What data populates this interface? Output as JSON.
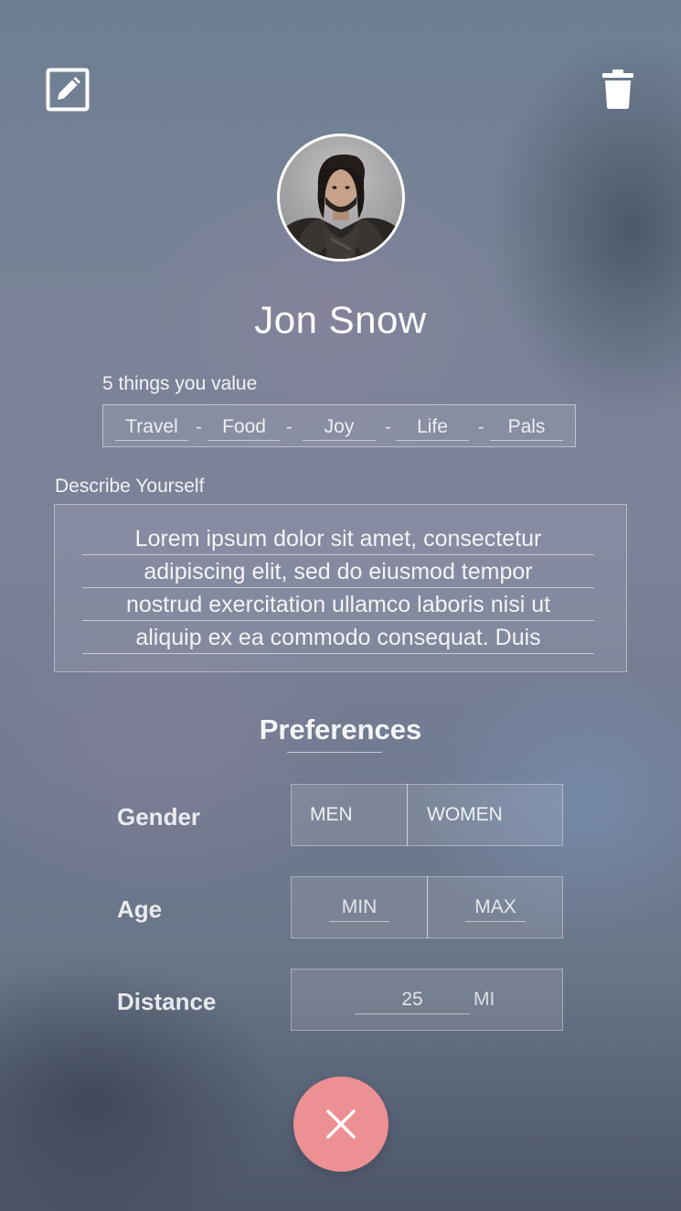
{
  "header": {
    "edit_icon": "edit-icon",
    "delete_icon": "trash-icon"
  },
  "profile": {
    "name": "Jon Snow"
  },
  "values": {
    "label": "5 things you value",
    "items": [
      "Travel",
      "Food",
      "Joy",
      "Life",
      "Pals"
    ],
    "separator": "-"
  },
  "describe": {
    "label": "Describe Yourself",
    "lines": [
      "Lorem ipsum dolor sit amet, consectetur",
      "adipiscing elit, sed do eiusmod tempor",
      "nostrud exercitation ullamco laboris nisi ut",
      "aliquip ex ea commodo consequat. Duis"
    ]
  },
  "preferences": {
    "title": "Preferences",
    "gender": {
      "label": "Gender",
      "options": [
        "MEN",
        "WOMEN"
      ]
    },
    "age": {
      "label": "Age",
      "min_placeholder": "MIN",
      "max_placeholder": "MAX"
    },
    "distance": {
      "label": "Distance",
      "value": "25",
      "unit": "MI"
    }
  },
  "actions": {
    "close_icon": "close-icon",
    "close_color": "#ec9094"
  }
}
